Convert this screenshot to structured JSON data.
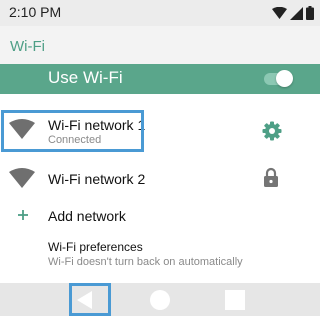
{
  "status_bar": {
    "time": "2:10 PM"
  },
  "app_title": "Wi-Fi",
  "master_toggle": {
    "label": "Use Wi-Fi",
    "state": "on"
  },
  "networks": [
    {
      "name": "Wi-Fi network 1",
      "status": "Connected",
      "action_icon": "gear-icon"
    },
    {
      "name": "Wi-Fi network 2",
      "action_icon": "lock-icon"
    }
  ],
  "add_network": {
    "label": "Add network"
  },
  "preferences": {
    "title": "Wi-Fi preferences",
    "summary": "Wi-Fi doesn't turn back on automatically"
  },
  "colors": {
    "accent": "#4e9f86",
    "master_bar": "#5aa68b",
    "focus_highlight": "#4a9ad4"
  },
  "nav_bar": {
    "buttons": [
      "back-icon",
      "home-icon",
      "recents-icon"
    ]
  }
}
